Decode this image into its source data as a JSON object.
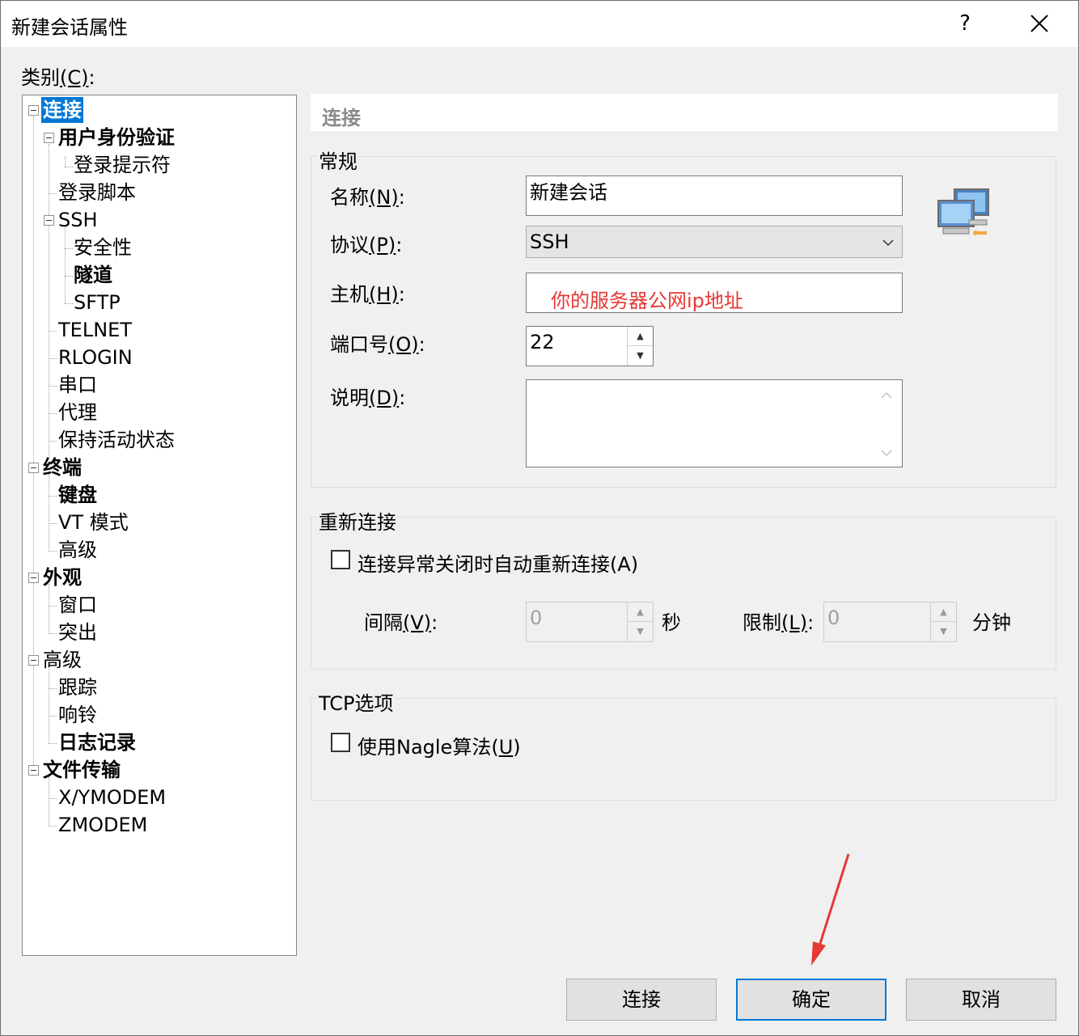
{
  "window": {
    "title": "新建会话属性",
    "help": "?",
    "close": "✕"
  },
  "category_label": {
    "text": "类别",
    "accel": "(C)",
    "colon": ":"
  },
  "tree": {
    "connection": "连接",
    "authentication": "用户身份验证",
    "login_prompts": "登录提示符",
    "login_script": "登录脚本",
    "ssh": "SSH",
    "security": "安全性",
    "tunnel": "隧道",
    "sftp": "SFTP",
    "telnet": "TELNET",
    "rlogin": "RLOGIN",
    "serial": "串口",
    "proxy": "代理",
    "keepalive": "保持活动状态",
    "terminal": "终端",
    "keyboard": "键盘",
    "vt_mode": "VT 模式",
    "term_advanced": "高级",
    "appearance": "外观",
    "window": "窗口",
    "highlight": "突出",
    "advanced": "高级",
    "trace": "跟踪",
    "bell": "响铃",
    "logging": "日志记录",
    "file_transfer": "文件传输",
    "xymodem": "X/YMODEM",
    "zmodem": "ZMODEM"
  },
  "section_title": "连接",
  "general": {
    "group_label": "常规",
    "name_label": "名称",
    "name_accel": "(N)",
    "name_value": "新建会话",
    "protocol_label": "协议",
    "protocol_accel": "(P)",
    "protocol_value": "SSH",
    "host_label": "主机",
    "host_accel": "(H)",
    "host_value": "你的服务器公网ip地址",
    "port_label": "端口号",
    "port_accel": "(O)",
    "port_value": "22",
    "desc_label": "说明",
    "desc_accel": "(D)",
    "desc_value": "",
    "colon": ":"
  },
  "reconnect": {
    "group_label": "重新连接",
    "auto_reconnect_label": "连接异常关闭时自动重新连接(A)",
    "auto_reconnect_checked": false,
    "interval_label": "间隔",
    "interval_accel": "(V)",
    "interval_value": "0",
    "interval_unit": "秒",
    "limit_label": "限制",
    "limit_accel": "(L)",
    "limit_value": "0",
    "limit_unit": "分钟",
    "colon": ":"
  },
  "tcp": {
    "group_label": "TCP选项",
    "nagle_label_a": "使用Nagle算法(",
    "nagle_accel": "U",
    "nagle_label_b": ")",
    "nagle_checked": false
  },
  "buttons": {
    "connect": "连接",
    "ok": "确定",
    "cancel": "取消"
  },
  "colors": {
    "annotation": "#e53935",
    "selection": "#0078d7"
  }
}
